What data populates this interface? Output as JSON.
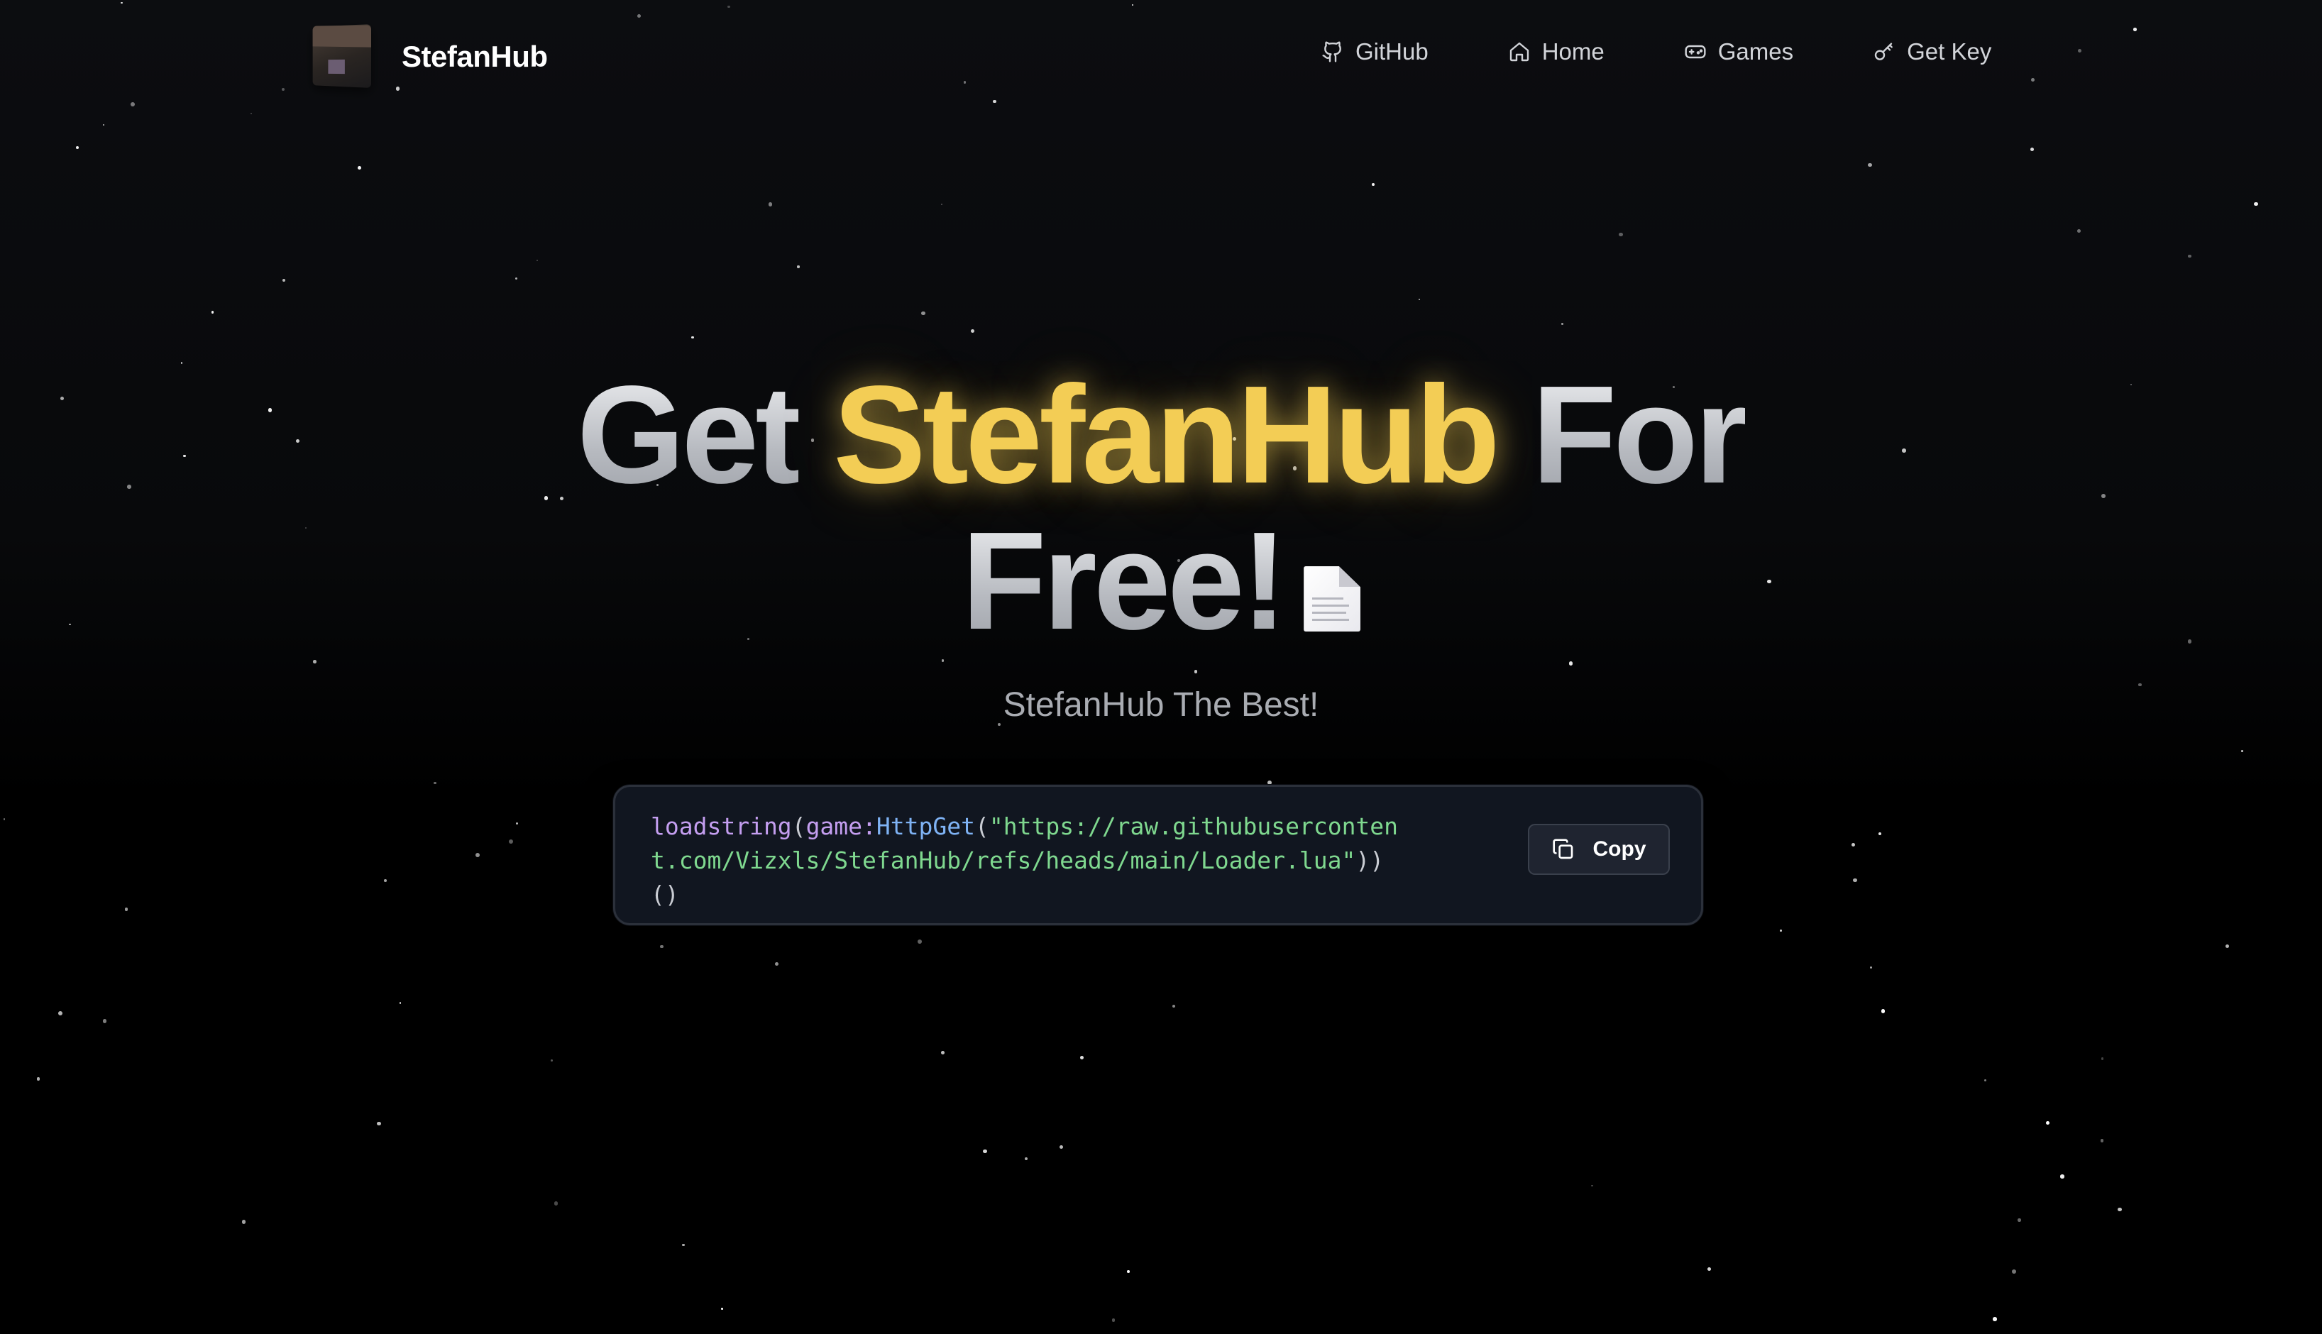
{
  "brand": {
    "name": "StefanHub",
    "logo_icon": "avatar-cube-icon"
  },
  "nav": {
    "links": [
      {
        "label": "GitHub",
        "icon": "github-icon"
      },
      {
        "label": "Home",
        "icon": "home-icon"
      },
      {
        "label": "Games",
        "icon": "gamepad-icon"
      },
      {
        "label": "Get Key",
        "icon": "key-icon"
      }
    ]
  },
  "hero": {
    "headline_part1": "Get",
    "headline_highlight": "StefanHub",
    "headline_part2": "For",
    "headline_part3": "Free!",
    "headline_emoji_icon": "document-icon",
    "subtitle": "StefanHub The Best!"
  },
  "code": {
    "fn": "loadstring",
    "open1": "(",
    "obj": "game",
    "colon": ":",
    "method": "HttpGet",
    "open2": "(",
    "string": "\"https://raw.githubusercontent.com/Vizxls/StefanHub/refs/heads/main/Loader.lua\"",
    "close": "))()",
    "copy_label": "Copy",
    "copy_icon": "copy-icon"
  },
  "colors": {
    "background": "#000000",
    "accent": "#f3cd55",
    "code_bg": "#111620",
    "code_fn": "#c49ef0",
    "code_method": "#7fb3f5",
    "code_string": "#7fd88f"
  }
}
